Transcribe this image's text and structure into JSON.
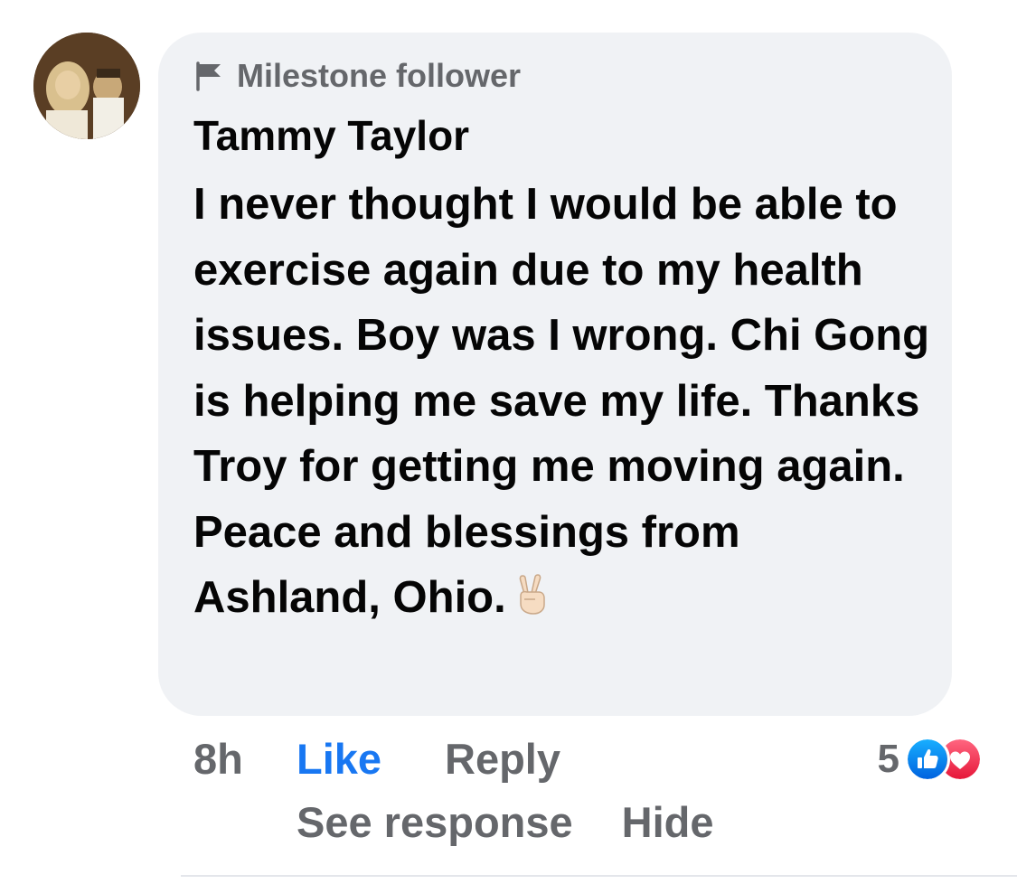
{
  "comment": {
    "badge_label": "Milestone follower",
    "badge_icon": "flag-icon",
    "author": "Tammy Taylor",
    "text": "I never thought I would be able to exercise again due to my health issues. Boy was I wrong. Chi Gong is helping me save my life. Thanks Troy for getting me moving again. Peace and blessings from Ashland, Ohio.",
    "emoji": "victory-hand-icon",
    "time": "8h",
    "like_label": "Like",
    "reply_label": "Reply",
    "reaction_count": "5",
    "reaction_icons": [
      "like-reaction-icon",
      "love-reaction-icon"
    ],
    "see_response_label": "See response",
    "hide_label": "Hide"
  },
  "colors": {
    "bubble": "#f0f2f5",
    "like_blue": "#1877f2",
    "secondary_text": "#65676b",
    "primary_text": "#050505",
    "love_red": "#f33e58"
  }
}
